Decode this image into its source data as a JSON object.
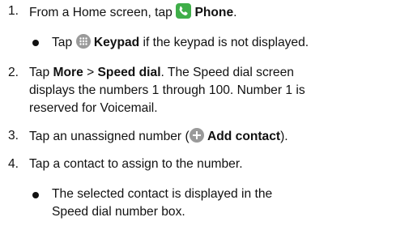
{
  "steps": [
    {
      "number": "1.",
      "prefix": "From a Home screen, tap",
      "icon": "phone-icon",
      "bold": "Phone",
      "suffix": ".",
      "sub": {
        "prefix": "Tap",
        "icon": "keypad-icon",
        "bold": "Keypad",
        "suffix": " if the keypad is not displayed."
      }
    },
    {
      "number": "2.",
      "text_tap": "Tap ",
      "bold_more": "More",
      "sep": " > ",
      "bold_speed": "Speed dial",
      "rest_line1": ". The Speed dial screen",
      "line2": "displays the numbers 1 through 100. Number 1 is",
      "line3": "reserved for Voicemail."
    },
    {
      "number": "3.",
      "prefix": "Tap an unassigned number (",
      "icon": "add-contact-icon",
      "bold": "Add contact",
      "suffix": ")."
    },
    {
      "number": "4.",
      "text": "Tap a contact to assign to the number.",
      "sub_line1": "The selected contact is displayed in the",
      "sub_line2": "Speed dial number box."
    }
  ],
  "colors": {
    "text": "#111111",
    "icon_green": "#3fae49",
    "icon_gray": "#9a9a9a"
  }
}
